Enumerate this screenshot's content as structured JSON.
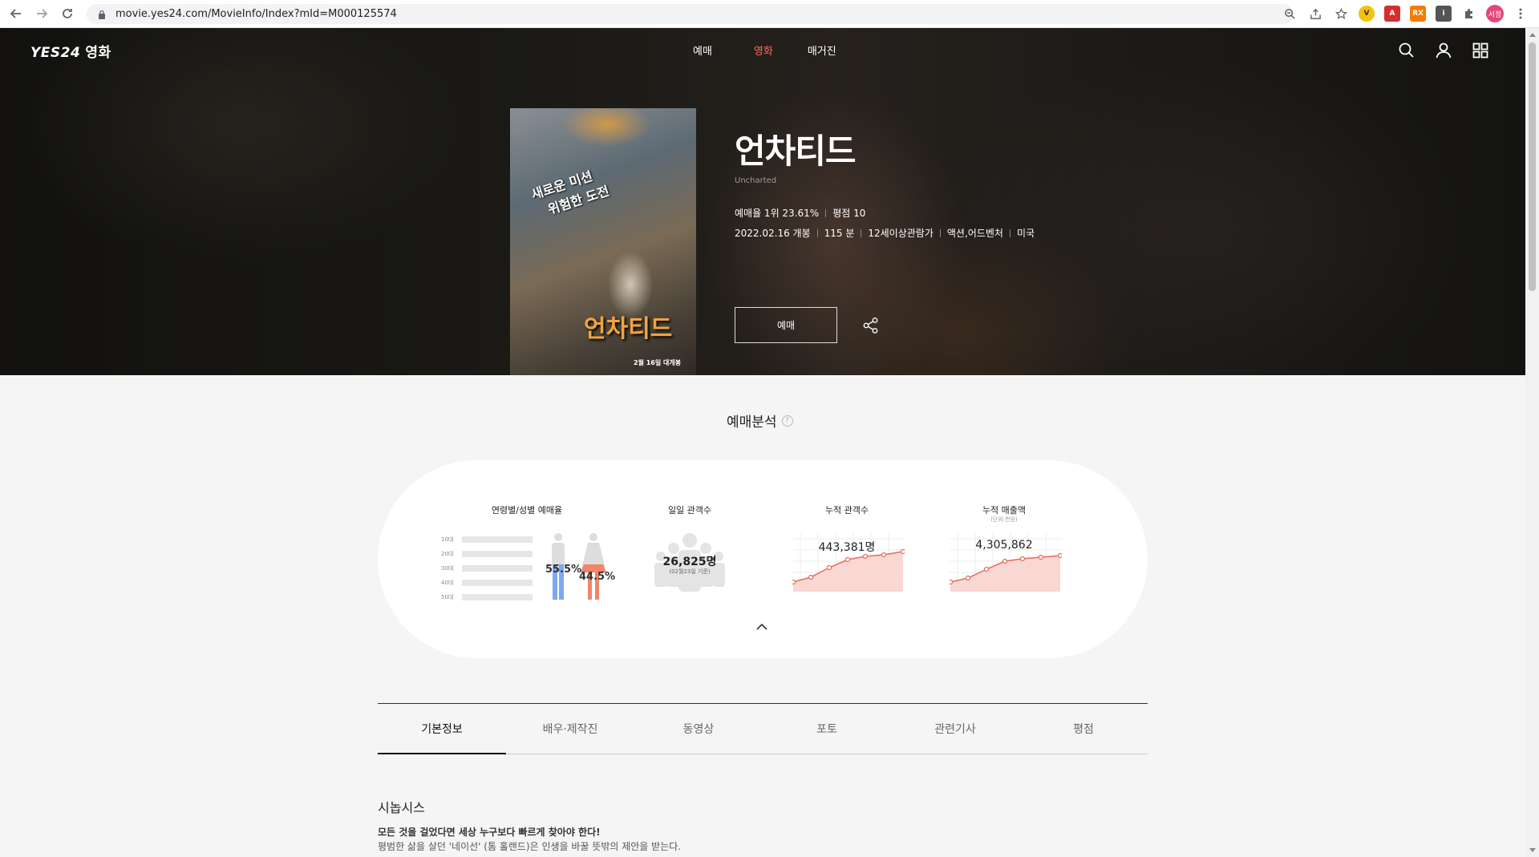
{
  "browser": {
    "url": "movie.yes24.com/MovieInfo/Index?mId=M000125574",
    "profile_label": "서정",
    "extensions": [
      {
        "name": "v-extension-icon",
        "letter": "V",
        "color": "#f4c20d"
      },
      {
        "name": "pdf-extension-icon",
        "letter": "A",
        "color": "#d32f2f"
      },
      {
        "name": "rx-extension-icon",
        "letter": "RX",
        "color": "#f57c00"
      },
      {
        "name": "info-extension-icon",
        "letter": "i",
        "color": "#555555"
      }
    ]
  },
  "site": {
    "logo_text": "YES24",
    "logo_sub": "영화",
    "menu": [
      "예매",
      "영화",
      "매거진"
    ],
    "accent_color": "#ff6b5e"
  },
  "movie": {
    "title_kr": "언차티드",
    "title_en": "Uncharted",
    "booking_rank": "예매율 1위 23.61%",
    "rating": "평점 10",
    "release": "2022.02.16 개봉",
    "runtime": "115 분",
    "age_rating": "12세이상관람가",
    "genre": "액션,어드벤처",
    "country": "미국",
    "book_button": "예매",
    "poster": {
      "tagline_line1": "새로운 미션",
      "tagline_line2": "위험한 도전",
      "title": "언차티드",
      "release_text": "2월 16일 대개봉"
    }
  },
  "analysis": {
    "section_title": "예매분석",
    "help_mark": "?",
    "age_gender": {
      "title": "연령별/성별 예매율",
      "age_labels": [
        "10대",
        "20대",
        "30대",
        "40대",
        "50대"
      ],
      "male_pct": "55.5%",
      "female_pct": "44.5%",
      "male_color": "#7fa8f0",
      "female_color": "#f0856a"
    },
    "daily": {
      "title": "일일 관객수",
      "value": "26,825명",
      "sub": "(02월23일 기준)"
    },
    "cumulative": {
      "title": "누적 관객수",
      "value": "443,381명"
    },
    "sales": {
      "title": "누적 매출액",
      "unit": "(단위:천원)",
      "value": "4,305,862"
    }
  },
  "tabs": [
    "기본정보",
    "배우·제작진",
    "동영상",
    "포토",
    "관련기사",
    "평점"
  ],
  "active_tab": 0,
  "synopsis": {
    "title": "시놉시스",
    "headline": "모든 것을 걸었다면 세상 누구보다 빠르게 찾아야 한다!",
    "body": "평범한 삶을 살던 '네이선' (톰 홀랜드)은 인생을 바꿀 뜻밖의 제안을 받는다."
  }
}
